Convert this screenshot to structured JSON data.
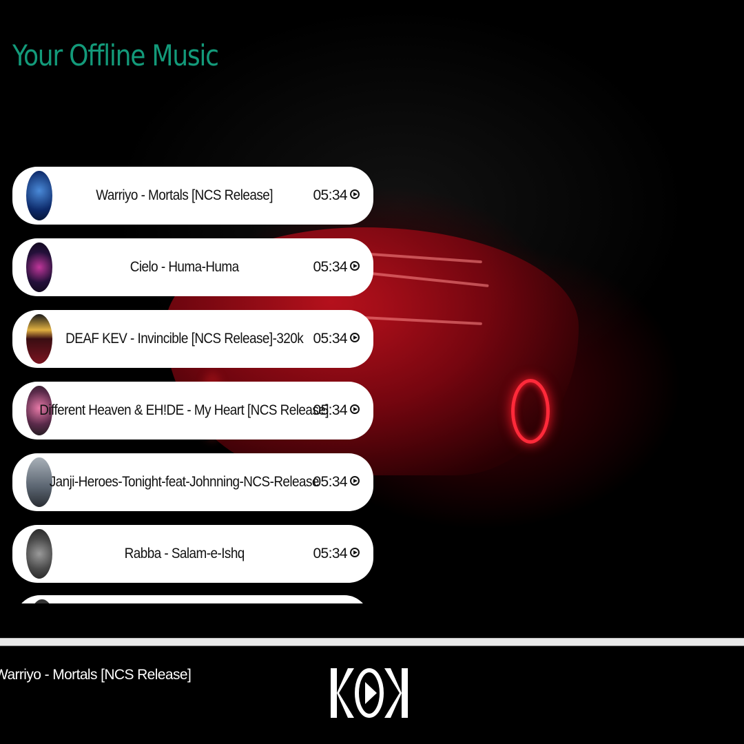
{
  "header": {
    "title": "Your Offline Music"
  },
  "tracks": [
    {
      "name": "Warriyo - Mortals [NCS Release]",
      "duration": "05:34",
      "cover_color": "#0d2a6a"
    },
    {
      "name": "Cielo - Huma-Huma",
      "duration": "05:34",
      "cover_color": "#24103a"
    },
    {
      "name": "DEAF KEV - Invincible [NCS Release]-320k",
      "duration": "05:34",
      "cover_color": "#3a0d12"
    },
    {
      "name": "Different Heaven & EH!DE - My Heart [NCS Release]",
      "duration": "05:34",
      "cover_color": "#3a2a3a"
    },
    {
      "name": "Janji-Heroes-Tonight-feat-Johnning-NCS-Release",
      "duration": "05:34",
      "cover_color": "#5a6470"
    },
    {
      "name": "Rabba - Salam-e-Ishq",
      "duration": "05:34",
      "cover_color": "#4a4a4a"
    }
  ],
  "player": {
    "now_playing": "Warriyo - Mortals [NCS Release]",
    "previous_icon": "skip-previous-icon",
    "play_icon": "play-icon",
    "next_icon": "skip-next-icon"
  },
  "colors": {
    "accent": "#139a7a",
    "background": "#000000",
    "card": "#ffffff"
  }
}
